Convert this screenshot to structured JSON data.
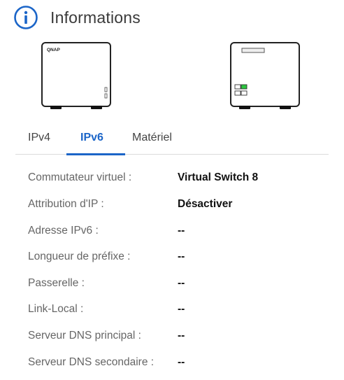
{
  "header": {
    "title": "Informations",
    "icon": "info-icon",
    "icon_color": "#1b65c8"
  },
  "devices": {
    "front_brand": "QNAP",
    "led_green": "#2cc53f"
  },
  "tabs": [
    {
      "label": "IPv4",
      "active": false
    },
    {
      "label": "IPv6",
      "active": true
    },
    {
      "label": "Matériel",
      "active": false
    }
  ],
  "details": [
    {
      "label": "Commutateur virtuel :",
      "value": "Virtual Switch 8"
    },
    {
      "label": "Attribution d'IP :",
      "value": "Désactiver"
    },
    {
      "label": "Adresse IPv6  :",
      "value": "--"
    },
    {
      "label": "Longueur de préfixe :",
      "value": "--"
    },
    {
      "label": "Passerelle :",
      "value": "--"
    },
    {
      "label": "Link-Local :",
      "value": "--"
    },
    {
      "label": "Serveur DNS principal :",
      "value": "--"
    },
    {
      "label": "Serveur DNS secondaire :",
      "value": "--"
    }
  ],
  "colors": {
    "accent": "#1b65c8",
    "divider": "#dcdcdc"
  }
}
